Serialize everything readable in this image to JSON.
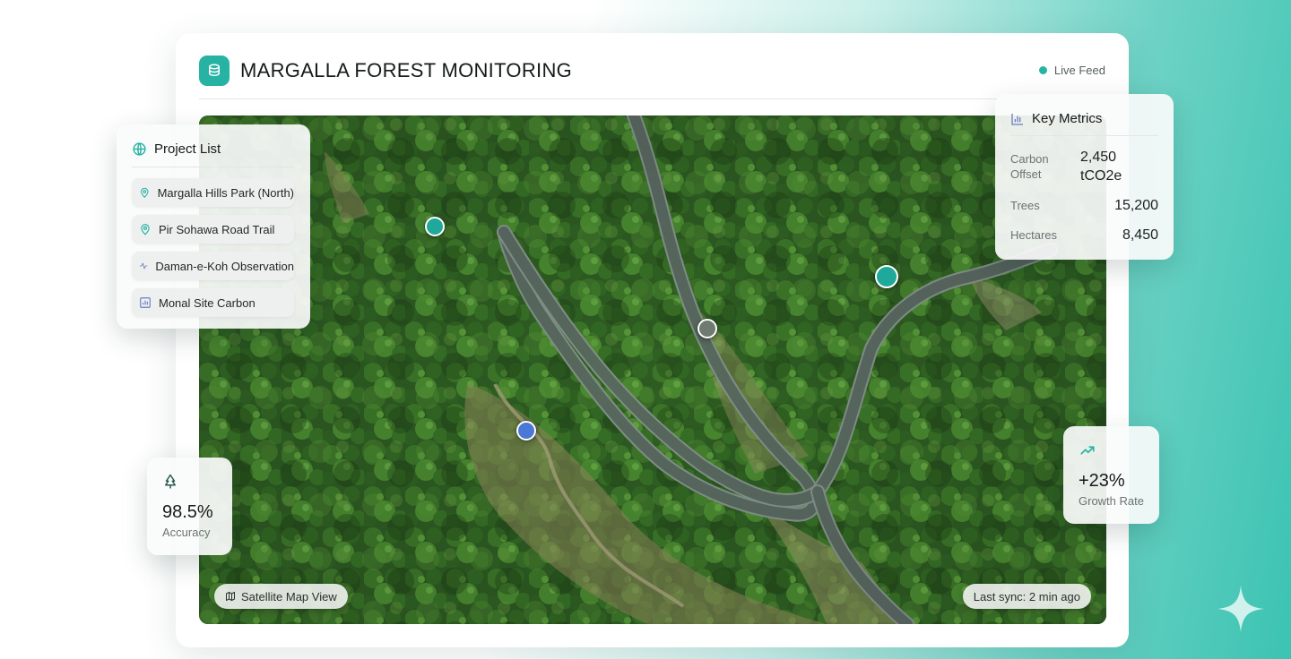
{
  "header": {
    "title": "MARGALLA FOREST MONITORING",
    "live_feed": "Live Feed",
    "accent": "#27b3a3"
  },
  "project_list": {
    "title": "Project List",
    "items": [
      {
        "label": "Margalla Hills Park (North)",
        "icon": "map-pin-icon"
      },
      {
        "label": "Pir Sohawa Road Trail",
        "icon": "map-pin-icon"
      },
      {
        "label": "Daman-e-Koh Observation",
        "icon": "activity-icon"
      },
      {
        "label": "Monal Site Carbon",
        "icon": "chart-square-icon"
      }
    ]
  },
  "key_metrics": {
    "title": "Key Metrics",
    "rows": [
      {
        "label": "Carbon Offset",
        "value": "2,450 tCO2e"
      },
      {
        "label": "Trees",
        "value": "15,200"
      },
      {
        "label": "Hectares",
        "value": "8,450"
      }
    ]
  },
  "accuracy": {
    "value": "98.5%",
    "label": "Accuracy",
    "icon": "tree-icon"
  },
  "growth": {
    "value": "+23%",
    "label": "Growth Rate",
    "icon": "trending-up-icon"
  },
  "map": {
    "view_label": "Satellite Map View",
    "last_sync": "Last sync: 2 min ago",
    "pin_colors": {
      "teal": "#1fa99a",
      "gray": "#6f7a70",
      "blue": "#4a78d4"
    }
  }
}
